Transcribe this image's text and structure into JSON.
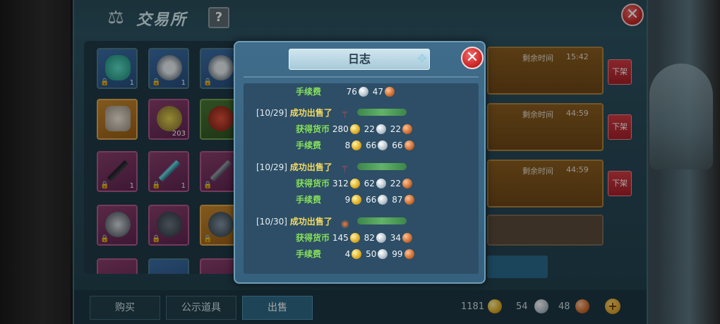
{
  "window": {
    "title": "交易所",
    "help_label": "?",
    "close_label": "✕"
  },
  "inventory": {
    "slots": [
      {
        "qty": "1"
      },
      {
        "qty": "1"
      },
      {
        "qty": "1"
      },
      {
        "qty": ""
      },
      {
        "qty": "203"
      },
      {
        "qty": ""
      },
      {
        "qty": "1"
      },
      {
        "qty": "1"
      },
      {
        "qty": "1"
      },
      {
        "qty": ""
      },
      {
        "qty": ""
      },
      {
        "qty": ""
      }
    ]
  },
  "listings": [
    {
      "time_label": "剩余时间",
      "time_value": "15:42",
      "unlist_label": "下架"
    },
    {
      "time_label": "剩余时间",
      "time_value": "44:59",
      "unlist_label": "下架"
    },
    {
      "time_label": "剩余时间",
      "time_value": "44:59",
      "unlist_label": "下架"
    }
  ],
  "bottom": {
    "tabs": [
      "购买",
      "公示道具",
      "出售"
    ],
    "active_tab": "出售",
    "gold": "1181",
    "silver": "54",
    "copper": "48",
    "add_label": "+"
  },
  "dialog": {
    "title": "日志",
    "close_label": "✕",
    "fee_label": "手续费",
    "earn_label": "获得货币",
    "sold_label": "成功出售了",
    "top_fee": {
      "silver": "76",
      "copper": "47"
    },
    "entries": [
      {
        "date": "[10/29]",
        "earn": {
          "gold": "280",
          "silver": "22",
          "copper": "22"
        },
        "fee": {
          "gold": "8",
          "silver": "66",
          "copper": "66"
        }
      },
      {
        "date": "[10/29]",
        "earn": {
          "gold": "312",
          "silver": "62",
          "copper": "22"
        },
        "fee": {
          "gold": "9",
          "silver": "66",
          "copper": "87"
        }
      },
      {
        "date": "[10/30]",
        "earn": {
          "gold": "145",
          "silver": "82",
          "copper": "34"
        },
        "fee": {
          "gold": "4",
          "silver": "50",
          "copper": "99"
        }
      }
    ]
  },
  "colors": {
    "panel": "#2f5564",
    "dialog": "#3f6c8a",
    "green_label": "#86e05a",
    "yellow_label": "#f3da62",
    "close_red": "#cf2a2a"
  }
}
